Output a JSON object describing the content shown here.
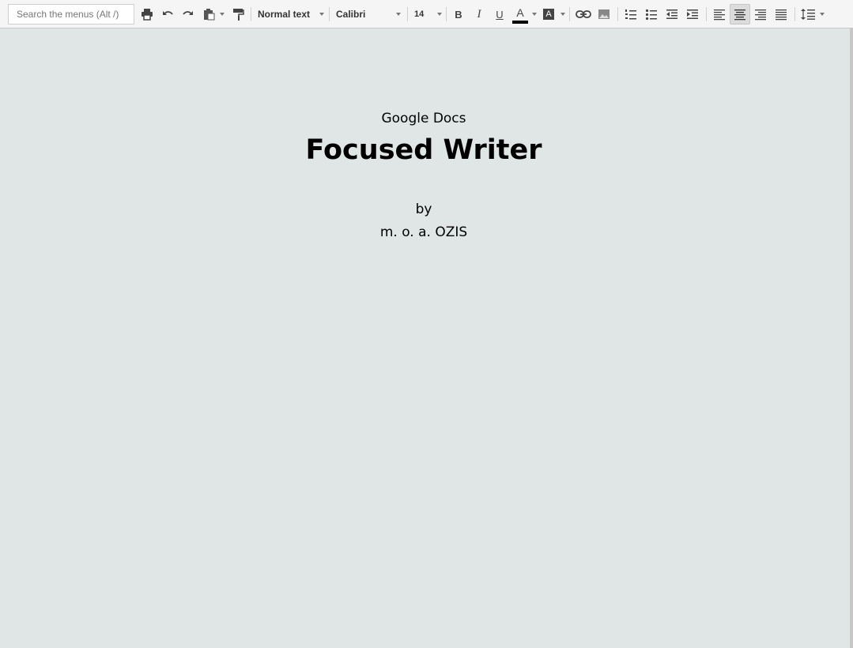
{
  "toolbar": {
    "search": {
      "placeholder": "Search the menus (Alt /)",
      "value": ""
    },
    "icons": {
      "print": "print-icon",
      "undo": "undo-icon",
      "redo": "redo-icon",
      "paste": "clipboard-icon",
      "paint_format": "paint-roller-icon",
      "bold": "bold-icon",
      "italic": "italic-icon",
      "underline": "underline-icon",
      "text_color": "text-color-icon",
      "highlight": "highlight-color-icon",
      "link": "link-icon",
      "image": "image-icon",
      "numbered_list": "numbered-list-icon",
      "bulleted_list": "bulleted-list-icon",
      "decrease_indent": "decrease-indent-icon",
      "increase_indent": "increase-indent-icon",
      "align_left": "align-left-icon",
      "align_center": "align-center-icon",
      "align_right": "align-right-icon",
      "justify": "justify-icon",
      "line_spacing": "line-spacing-icon"
    },
    "paragraph_style": "Normal text",
    "font_family": "Calibri",
    "font_size": "14",
    "bold_glyph": "B",
    "italic_glyph": "I",
    "underline_glyph": "U",
    "text_color_glyph": "A",
    "highlight_glyph": "A",
    "text_color": "#000000",
    "active_alignment": "center"
  },
  "document": {
    "subtitle": "Google Docs",
    "title": "Focused Writer",
    "byline": "by",
    "author": "m. o. a. OZIS"
  },
  "colors": {
    "page_background": "#e0e6e5",
    "toolbar_background": "#f5f5f5"
  }
}
